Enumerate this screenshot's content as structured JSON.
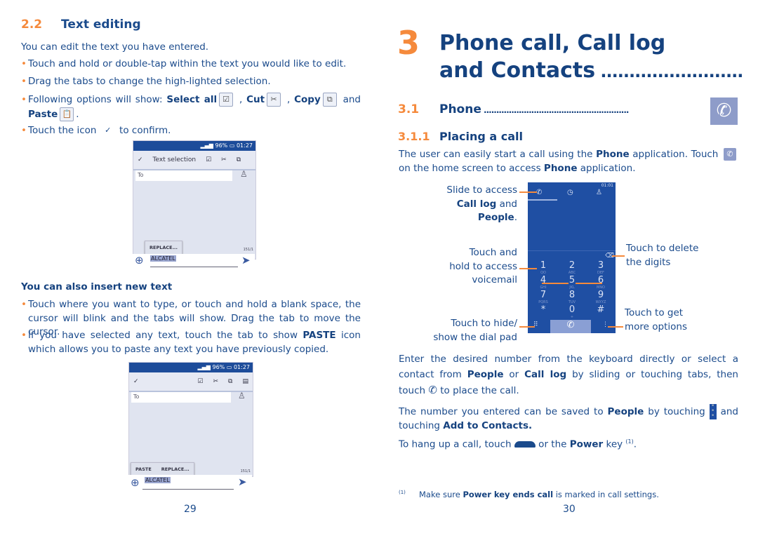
{
  "left": {
    "section_num": "2.2",
    "section_title": "Text editing",
    "intro": "You can edit the text you have entered.",
    "b1": "Touch and hold or double-tap within the text you would like to edit.",
    "b2": "Drag the tabs to change the high-lighted selection.",
    "b3": {
      "a": "Following options will show: ",
      "select_all": "Select all",
      "c1": " , ",
      "cut": "Cut",
      "c2": " , ",
      "copy": "Copy",
      "and": " and ",
      "paste": "Paste",
      "end": "."
    },
    "b4": {
      "a": "Touch the icon ",
      "b": " to confirm."
    },
    "phone1": {
      "battery": "96%",
      "time": "01:27",
      "toolbar_title": "Text selection",
      "to": "To",
      "popup": "REPLACE...",
      "selected": "ALCATEL",
      "counter": "151/1"
    },
    "subheading": "You can also insert new text",
    "b5": "Touch where you want to type, or touch and hold a blank space, the cursor will blink and the tabs will show. Drag the tab to move the cursor.",
    "b6": {
      "a": "If you have selected any text, touch the tab to show ",
      "paste": "PASTE",
      "b": " icon which allows you to paste any text you have previously copied."
    },
    "phone2": {
      "battery": "96%",
      "time": "01:27",
      "to": "To",
      "paste": "PASTE",
      "replace": "REPLACE...",
      "selected": "ALCATEL",
      "counter": "151/1"
    },
    "page_number": "29"
  },
  "right": {
    "chapter_num": "3",
    "chapter_title_1": "Phone call, Call log",
    "chapter_title_2": "and Contacts",
    "chapter_dots": " .........................",
    "s31_num": "3.1",
    "s31_title": "Phone",
    "s31_dots": " ..........................................................",
    "s311_num": "3.1.1",
    "s311_title": "Placing a call",
    "p1": {
      "a": "The user can easily start a call using the ",
      "phone": "Phone",
      "b": " application. Touch ",
      "c": " on the home screen to access ",
      "phone2": "Phone",
      "d": " application."
    },
    "callouts": {
      "slide_1": "Slide to access",
      "slide_2": "Call log",
      "slide_2b": " and",
      "slide_3": "People",
      "slide_3b": ".",
      "hold_1": "Touch and",
      "hold_2": "hold to access",
      "hold_3": "voicemail",
      "hide_1": "Touch to hide/",
      "hide_2": "show the dial pad",
      "delete_1": "Touch to delete",
      "delete_2": "the digits",
      "more_1": "Touch to get",
      "more_2": "more options"
    },
    "dialer": {
      "time": "01:01",
      "keys": [
        "1",
        "2",
        "3",
        "4",
        "5",
        "6",
        "7",
        "8",
        "9",
        "*",
        "0",
        "#"
      ],
      "subs": [
        "QO",
        "ABC",
        "DEF",
        "GHI",
        "JKL",
        "MNO",
        "PQRS",
        "TUV",
        "WXYZ",
        "",
        "+",
        ""
      ]
    },
    "p2": {
      "a": "Enter the desired number from the keyboard directly or select a contact from ",
      "people": "People",
      "b": " or ",
      "calllog": "Call log",
      "c": " by sliding or touching tabs, then touch ",
      "d": " to place the call."
    },
    "p3": {
      "a": "The number you entered can be saved to ",
      "people": "People",
      "b": " by touching ",
      "c": " and touching ",
      "add": "Add to Contacts."
    },
    "p4": {
      "a": "To hang up a call, touch ",
      "b": " or the ",
      "power": "Power",
      "c": " key ",
      "sup": "(1)",
      "d": "."
    },
    "footnote": {
      "mark": "(1)",
      "a": "Make sure ",
      "bold": "Power key ends call",
      "b": " is marked in call settings."
    },
    "page_number": "30"
  },
  "colors": {
    "text": "#1b4b8c",
    "accent": "#f58a3c",
    "statusbar": "#1d4c9a"
  }
}
